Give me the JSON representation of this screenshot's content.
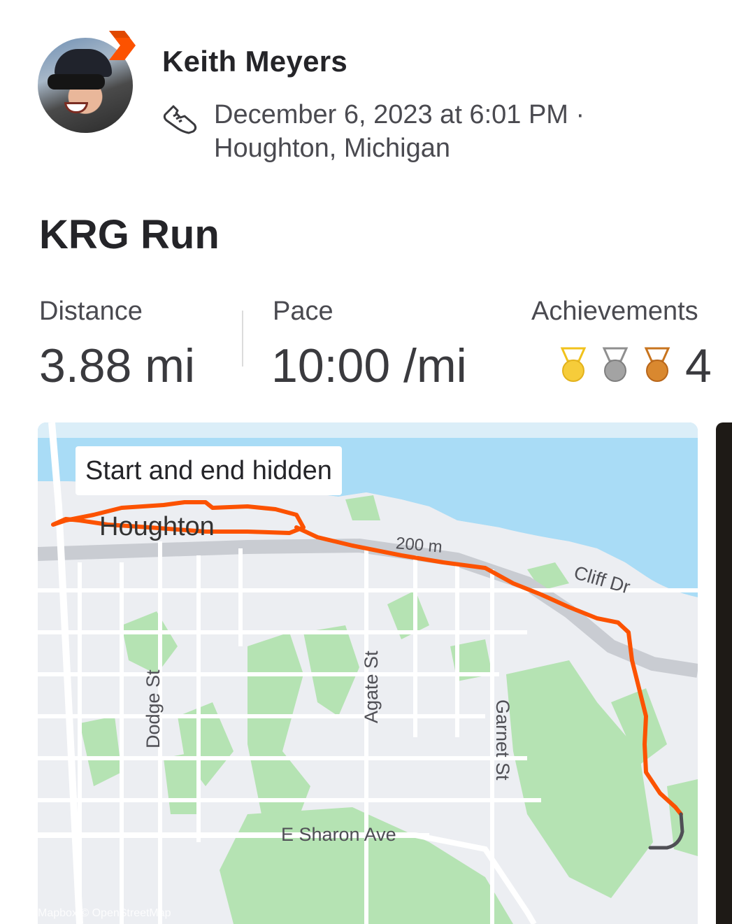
{
  "user": {
    "name": "Keith Meyers",
    "activity_icon": "shoe-icon",
    "date_line": "December 6, 2023 at 6:01 PM ·",
    "location": "Houghton, Michigan"
  },
  "activity": {
    "title": "KRG Run"
  },
  "stats": {
    "distance_label": "Distance",
    "distance_value": "3.88 mi",
    "pace_label": "Pace",
    "pace_value": "10:00 /mi",
    "achievements_label": "Achievements",
    "achievements_count": "4",
    "medals": [
      "gold-medal-icon",
      "silver-medal-icon",
      "bronze-medal-icon"
    ]
  },
  "map": {
    "privacy_label": "Start and end hidden",
    "town_label": "Houghton",
    "scale_label": "200 m",
    "streets": {
      "cliff": "Cliff Dr",
      "dodge": "Dodge St",
      "agate": "Agate St",
      "garnet": "Garnet St",
      "sharon": "E Sharon Ave"
    },
    "attribution": "Mapbox © OpenStreetMap",
    "colors": {
      "route": "#fc5200",
      "water": "#a9dcf6",
      "park": "#b5e3b3",
      "road": "#ffffff"
    }
  }
}
